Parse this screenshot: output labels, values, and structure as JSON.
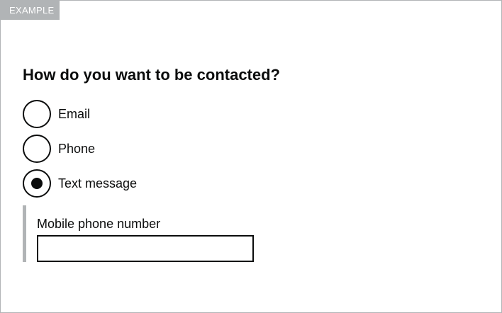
{
  "tag": {
    "label": "EXAMPLE"
  },
  "question": {
    "title": "How do you want to be contacted?"
  },
  "options": [
    {
      "label": "Email",
      "checked": false
    },
    {
      "label": "Phone",
      "checked": false
    },
    {
      "label": "Text message",
      "checked": true
    }
  ],
  "conditional": {
    "label": "Mobile phone number",
    "value": "",
    "placeholder": ""
  },
  "colors": {
    "text": "#0b0c0c",
    "border": "#b1b4b6",
    "tag_background": "#b1b4b6",
    "tag_text": "#ffffff"
  }
}
